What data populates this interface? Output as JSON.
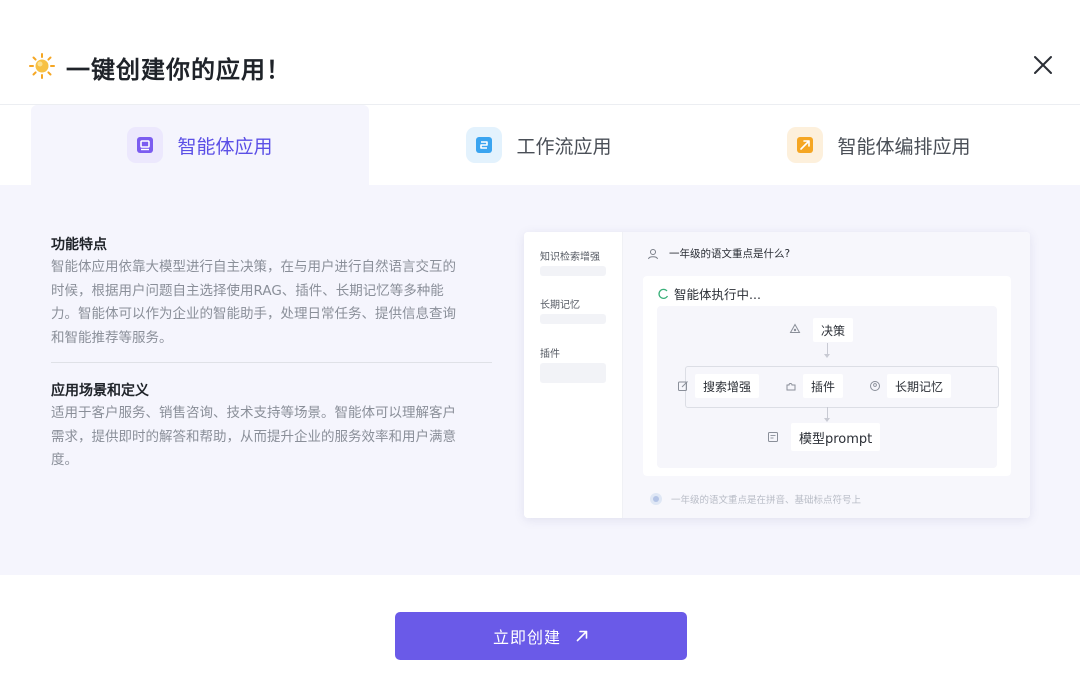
{
  "dialog": {
    "title": "一键创建你的应用！"
  },
  "tabs": [
    {
      "label": "智能体应用",
      "active": true,
      "icon": "agent-app-icon",
      "color": "#7b5cf0"
    },
    {
      "label": "工作流应用",
      "active": false,
      "icon": "workflow-app-icon",
      "color": "#3aa4f0"
    },
    {
      "label": "智能体编排应用",
      "active": false,
      "icon": "agent-orchestration-icon",
      "color": "#f5a623"
    }
  ],
  "features": {
    "title": "功能特点",
    "lines": [
      "智能体应用依靠大模型进行自主决策，在与用户进行自然语言交互的",
      "时候，根据用户问题自主选择使用RAG、插件、长期记忆等多种能",
      "力。智能体可以作为企业的智能助手，处理日常任务、提供信息查询",
      "和智能推荐等服务。"
    ]
  },
  "scenarios": {
    "title": "应用场景和定义",
    "lines": [
      "适用于客户服务、销售咨询、技术支持等场景。智能体可以理解客户",
      "需求，提供即时的解答和帮助，从而提升企业的服务效率和用户满意",
      "度。"
    ]
  },
  "preview": {
    "side_items": [
      "知识检索增强",
      "长期记忆",
      "插件"
    ],
    "question": "一年级的语文重点是什么?",
    "running": "智能体执行中...",
    "nodes": {
      "decision": "决策",
      "search": "搜索增强",
      "plugin": "插件",
      "memory": "长期记忆",
      "model": "模型prompt"
    },
    "answer": "一年级的语文重点是在拼音、基础标点符号上"
  },
  "footer": {
    "create_label": "立即创建"
  },
  "colors": {
    "accent": "#6a5ae8",
    "content_bg": "#f5f5fd"
  }
}
